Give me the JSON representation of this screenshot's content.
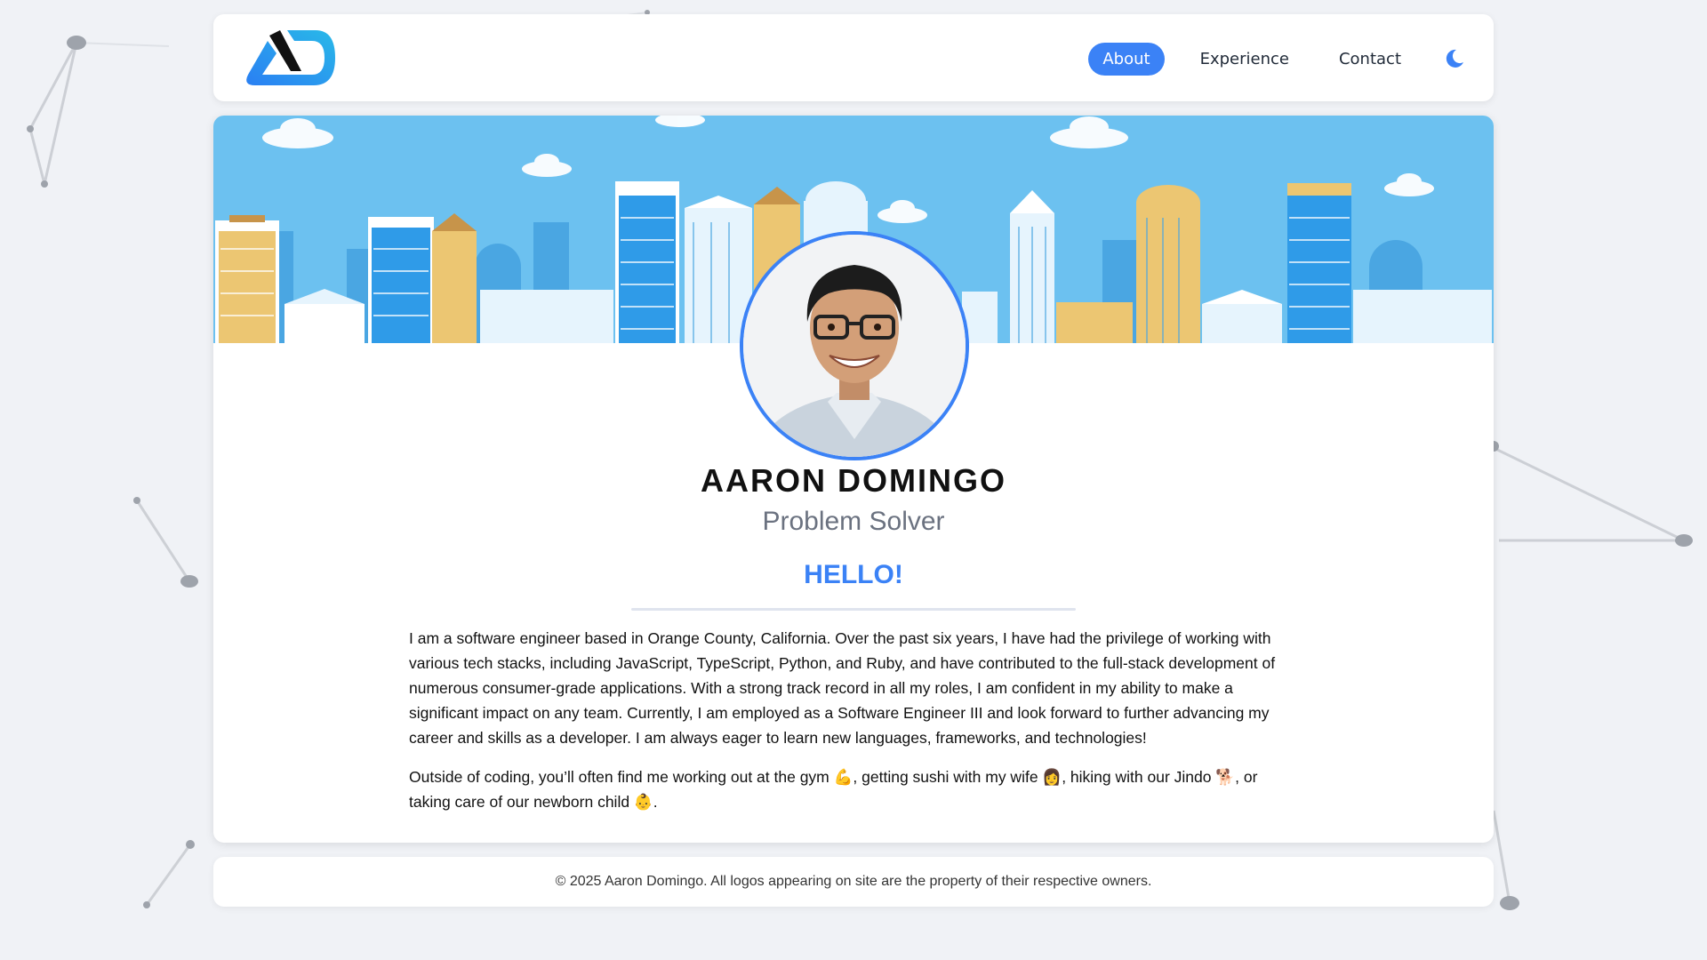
{
  "nav": {
    "items": [
      {
        "label": "About",
        "active": true
      },
      {
        "label": "Experience",
        "active": false
      },
      {
        "label": "Contact",
        "active": false
      }
    ],
    "theme_icon": "moon-icon"
  },
  "profile": {
    "name": "AARON DOMINGO",
    "title": "Problem Solver",
    "greeting": "HELLO!",
    "bio_paragraphs": [
      "I am a software engineer based in Orange County, California. Over the past six years, I have had the privilege of working with various tech stacks, including JavaScript, TypeScript, Python, and Ruby, and have contributed to the full-stack development of numerous consumer-grade applications. With a strong track record in all my roles, I am confident in my ability to make a significant impact on any team. Currently, I am employed as a Software Engineer III and look forward to further advancing my career and skills as a developer. I am always eager to learn new languages, frameworks, and technologies!",
      "Outside of coding, you’ll often find me working out at the gym 💪, getting sushi with my wife 👩, hiking with our Jindo 🐕, or taking care of our newborn child 👶."
    ]
  },
  "footer": {
    "text": "© 2025 Aaron Domingo. All logos appearing on site are the property of their respective owners."
  },
  "colors": {
    "accent": "#3b82f6",
    "sky": "#6cc1f0",
    "page_bg": "#f0f2f6"
  }
}
